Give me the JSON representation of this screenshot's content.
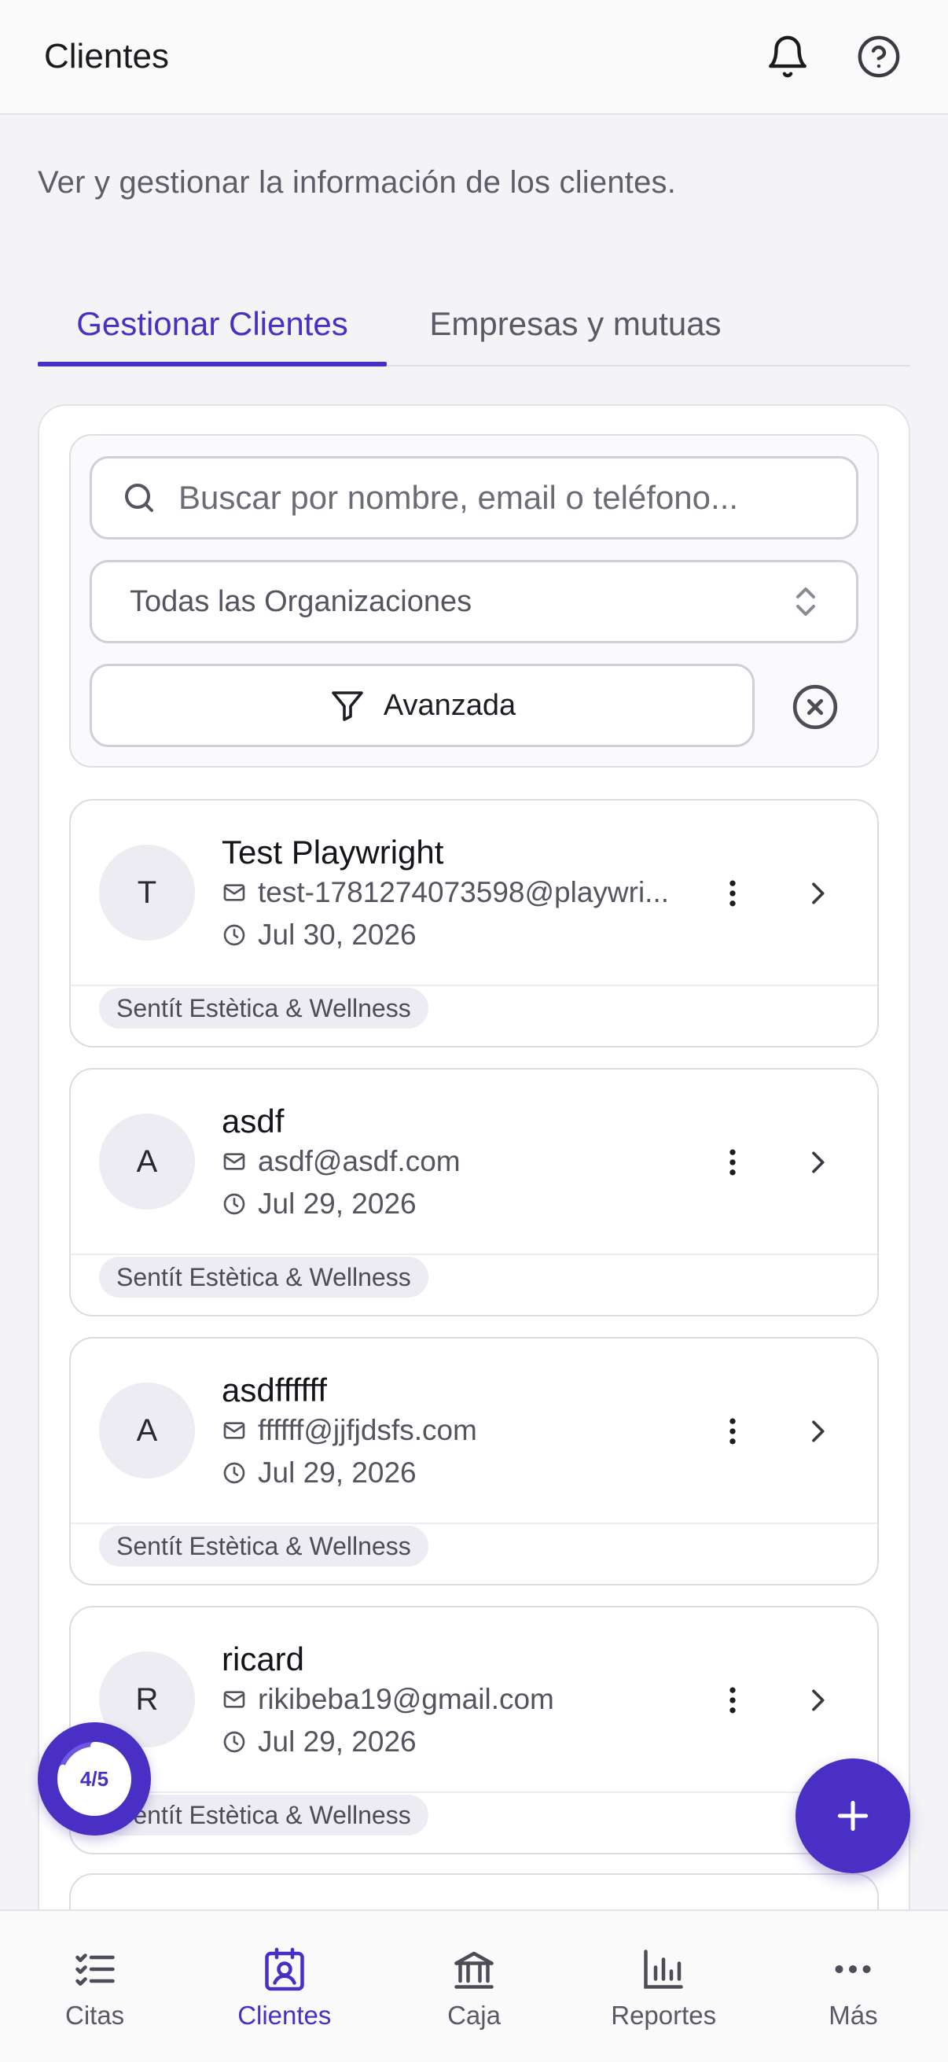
{
  "header": {
    "title": "Clientes",
    "icons": [
      "bell-icon",
      "help-circle-icon"
    ]
  },
  "subtitle": "Ver y gestionar la información de los clientes.",
  "tabs": [
    {
      "label": "Gestionar Clientes",
      "active": true
    },
    {
      "label": "Empresas y mutuas",
      "active": false
    }
  ],
  "filters": {
    "search_placeholder": "Buscar por nombre, email o teléfono...",
    "organization_select": "Todas las Organizaciones",
    "advanced_label": "Avanzada"
  },
  "clients": [
    {
      "initial": "T",
      "name": "Test Playwright",
      "email": "test-1781274073598@playwri...",
      "date": "Jul 30, 2026",
      "tag": "Sentít Estètica & Wellness"
    },
    {
      "initial": "A",
      "name": "asdf",
      "email": "asdf@asdf.com",
      "date": "Jul 29, 2026",
      "tag": "Sentít Estètica & Wellness"
    },
    {
      "initial": "A",
      "name": "asdffffff",
      "email": "ffffff@jjfjdsfs.com",
      "date": "Jul 29, 2026",
      "tag": "Sentít Estètica & Wellness"
    },
    {
      "initial": "R",
      "name": "ricard",
      "email": "rikibeba19@gmail.com",
      "date": "Jul 29, 2026",
      "tag": "Sentít Estètica & Wellness"
    }
  ],
  "progress": {
    "label": "4/5",
    "value": 0.8
  },
  "bottom_nav": [
    {
      "label": "Citas",
      "icon": "checklist-icon"
    },
    {
      "label": "Clientes",
      "icon": "contact-card-icon",
      "active": true
    },
    {
      "label": "Caja",
      "icon": "bank-icon"
    },
    {
      "label": "Reportes",
      "icon": "bar-chart-icon"
    },
    {
      "label": "Más",
      "icon": "more-horizontal-icon"
    }
  ],
  "colors": {
    "accent": "#4a2fc4",
    "background": "#f4f4f6"
  }
}
